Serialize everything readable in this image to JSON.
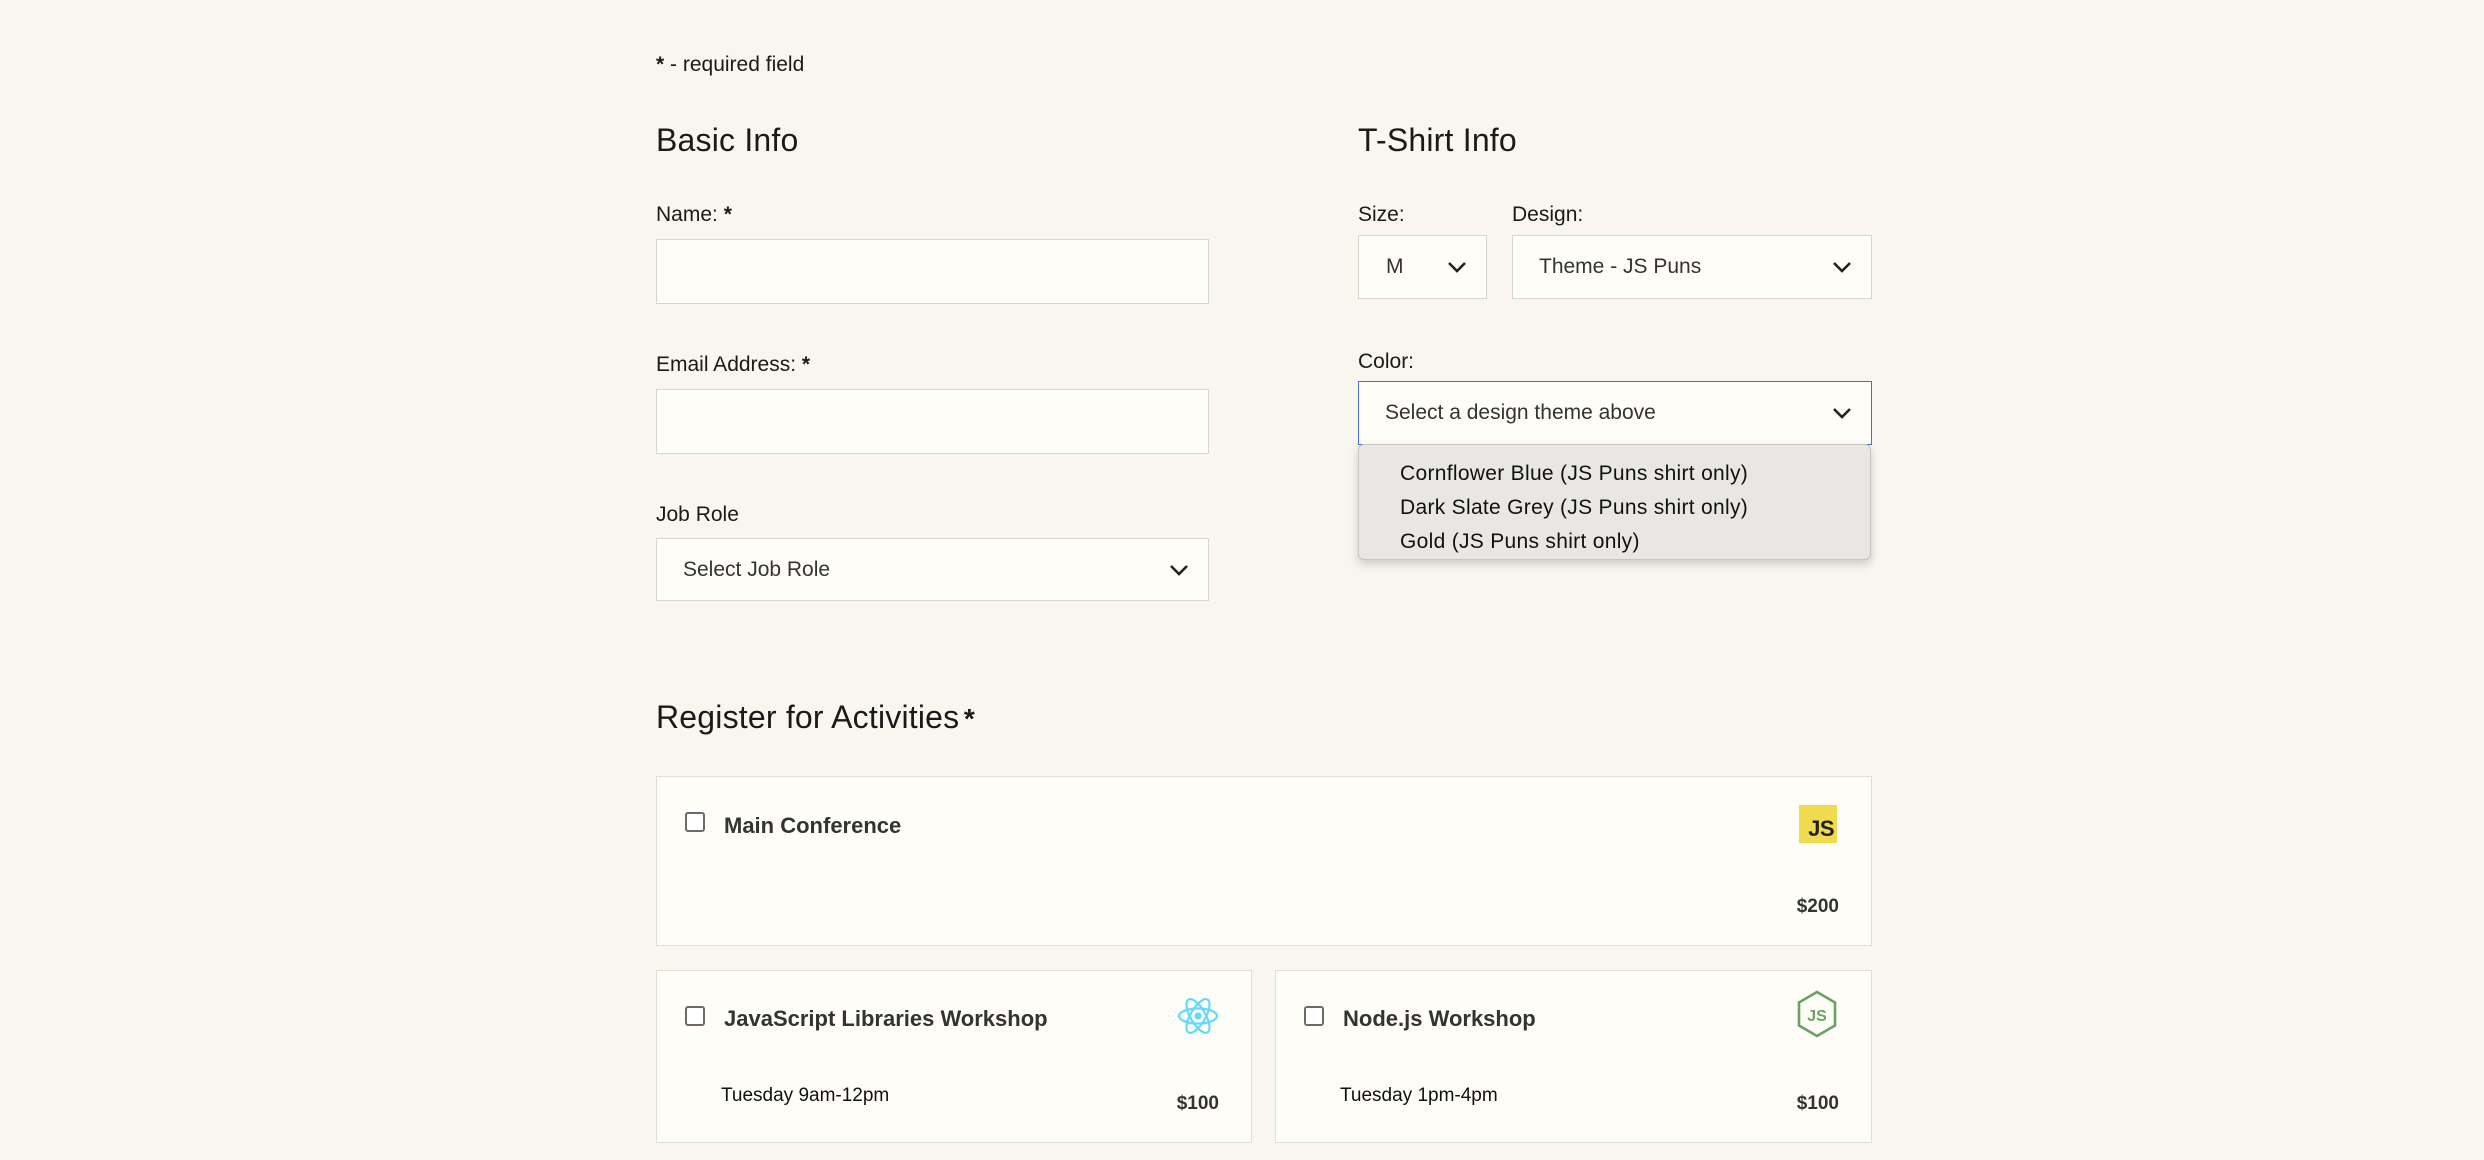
{
  "required_note": {
    "star": "*",
    "text": " - required field"
  },
  "basic_info": {
    "heading": "Basic Info",
    "name_label": "Name:",
    "email_label": "Email Address:",
    "job_role_label": "Job Role",
    "job_role_value": "Select Job Role",
    "required_star": "*"
  },
  "tshirt_info": {
    "heading": "T-Shirt Info",
    "size_label": "Size:",
    "size_value": "M",
    "design_label": "Design:",
    "design_value": "Theme - JS Puns",
    "color_label": "Color:",
    "color_value": "Select a design theme above",
    "color_options": [
      "Cornflower Blue (JS Puns shirt only)",
      "Dark Slate Grey (JS Puns shirt only)",
      "Gold (JS Puns shirt only)"
    ]
  },
  "activities": {
    "heading": "Register for Activities",
    "required_star": "*",
    "items": [
      {
        "title": "Main Conference",
        "time": "",
        "price": "$200",
        "icon": "javascript-icon",
        "icon_text": "JS"
      },
      {
        "title": "JavaScript Libraries Workshop",
        "time": "Tuesday 9am-12pm",
        "price": "$100",
        "icon": "react-icon"
      },
      {
        "title": "Node.js Workshop",
        "time": "Tuesday 1pm-4pm",
        "price": "$100",
        "icon": "nodejs-icon"
      }
    ]
  },
  "colors": {
    "background": "#f9f5ef",
    "field_background": "#fffdf8",
    "focus_border": "#4a6cd4",
    "js_yellow": "#f0db4f",
    "react_blue": "#61dafb",
    "node_green": "#6aa361"
  }
}
